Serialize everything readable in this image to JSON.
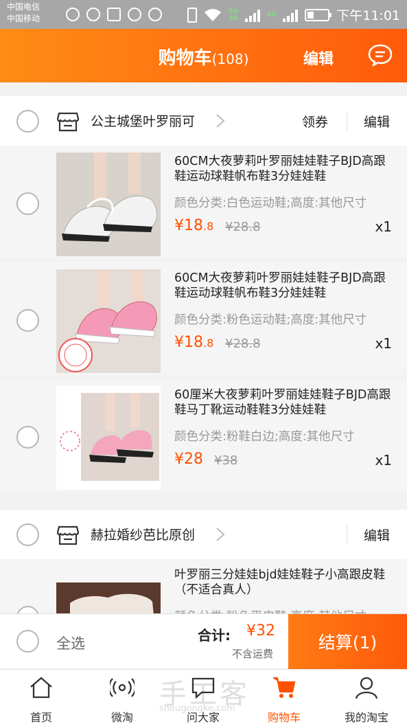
{
  "status_bar": {
    "carrier1": "中国电信",
    "carrier2": "中国移动",
    "net1": "3G",
    "net2": "2G",
    "net3": "4G",
    "time": "下午11:01"
  },
  "header": {
    "title": "购物车",
    "count": "(108)",
    "edit": "编辑",
    "message_icon": "chat-bubble-icon"
  },
  "stores": [
    {
      "name": "公主城堡叶罗丽可",
      "coupon": "领券",
      "edit": "编辑"
    },
    {
      "name": "赫拉婚纱芭比原创",
      "edit": "编辑"
    }
  ],
  "items": [
    {
      "name": "60CM大夜萝莉叶罗丽娃娃鞋子BJD高跟鞋运动球鞋帆布鞋3分娃娃鞋",
      "sku": "颜色分类:白色运动鞋;高度:其他尺寸",
      "price_int": "¥18",
      "price_dec": ".8",
      "old_price": "¥28.8",
      "qty": "x1",
      "thumb_color": "white"
    },
    {
      "name": "60CM大夜萝莉叶罗丽娃娃鞋子BJD高跟鞋运动球鞋帆布鞋3分娃娃鞋",
      "sku": "颜色分类:粉色运动鞋;高度:其他尺寸",
      "price_int": "¥18",
      "price_dec": ".8",
      "old_price": "¥28.8",
      "qty": "x1",
      "thumb_color": "pink"
    },
    {
      "name": "60厘米大夜萝莉叶罗丽娃娃鞋子BJD高跟鞋马丁靴运动鞋鞋3分娃娃鞋",
      "sku": "颜色分类:粉鞋白边;高度:其他尺寸",
      "price_int": "¥28",
      "price_dec": "",
      "old_price": "¥38",
      "qty": "x1",
      "thumb_color": "pink-heel"
    },
    {
      "name": "叶罗丽三分娃娃bjd娃娃鞋子小高跟皮鞋（不适合真人）",
      "sku": "颜色分类:粉色平皮鞋;高度:其他尺寸"
    }
  ],
  "bottom": {
    "select_all": "全选",
    "total_label": "合计:",
    "total": "¥32",
    "freight": "不含运费",
    "checkout": "结算(1)"
  },
  "tabs": [
    {
      "label": "首页",
      "icon": "home-icon"
    },
    {
      "label": "微淘",
      "icon": "broadcast-icon"
    },
    {
      "label": "问大家",
      "icon": "question-chat-icon"
    },
    {
      "label": "购物车",
      "icon": "cart-icon"
    },
    {
      "label": "我的淘宝",
      "icon": "user-icon"
    }
  ],
  "watermark": {
    "text": "手工客",
    "url": "shougongke.com"
  },
  "colors": {
    "accent": "#ff5000",
    "header_start": "#ff8c16",
    "header_end": "#ff5a0a"
  }
}
